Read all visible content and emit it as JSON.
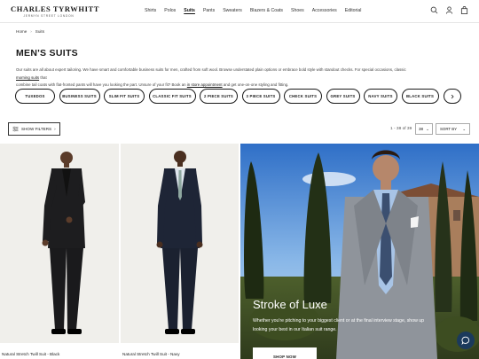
{
  "header": {
    "logo": "CHARLES TYRWHITT",
    "logo_sub": "JERMYN STREET LONDON",
    "nav": [
      "Shirts",
      "Polos",
      "Suits",
      "Pants",
      "Sweaters",
      "Blazers & Coats",
      "Shoes",
      "Accessories",
      "Editorial"
    ],
    "active_nav": "Suits",
    "icons": [
      "search-icon",
      "user-icon",
      "bag-icon"
    ]
  },
  "breadcrumb": [
    "Home",
    "Suits"
  ],
  "page": {
    "title": "MEN'S SUITS",
    "intro_line1_before": "Our suits are all about expert tailoring. We have smart and comfortable business suits for men, crafted from soft wool. Browse understated plain options or embrace bold style with standout checks. For special occasions, classic ",
    "intro_link1": "morning suits",
    "intro_line1_after": " that",
    "intro_line2_before": "combine tail coats with flat-fronted pants will have you looking the part. Unsure of your fit? Book an ",
    "intro_link2": "in store appointment",
    "intro_line2_after": " and get one-on-one styling and fitting."
  },
  "chips": [
    "TUXEDOS",
    "BUSINESS SUITS",
    "SLIM FIT SUITS",
    "CLASSIC FIT SUITS",
    "2 PIECE SUITS",
    "3 PIECE SUITS",
    "CHECK SUITS",
    "GREY SUITS",
    "NAVY SUITS",
    "BLACK SUITS"
  ],
  "toolbar": {
    "filters_label": "SHOW FILTERS",
    "count": "1 - 38 of 39",
    "per_page": "38",
    "sort_label": "SORT BY"
  },
  "products": [
    {
      "name": "Natural Stretch Twill Suit - Black"
    },
    {
      "name": "Natural Stretch Twill Suit - Navy"
    }
  ],
  "promo": {
    "title": "Stroke of Luxe",
    "text": "Whether you're pitching to your biggest client or at the final interview stage, show up looking your best in our Italian suit range.",
    "button": "SHOP NOW"
  },
  "colors": {
    "accent": "#1a1a1a",
    "chat": "#1b3a5c",
    "product_bg": "#f0efeb"
  }
}
